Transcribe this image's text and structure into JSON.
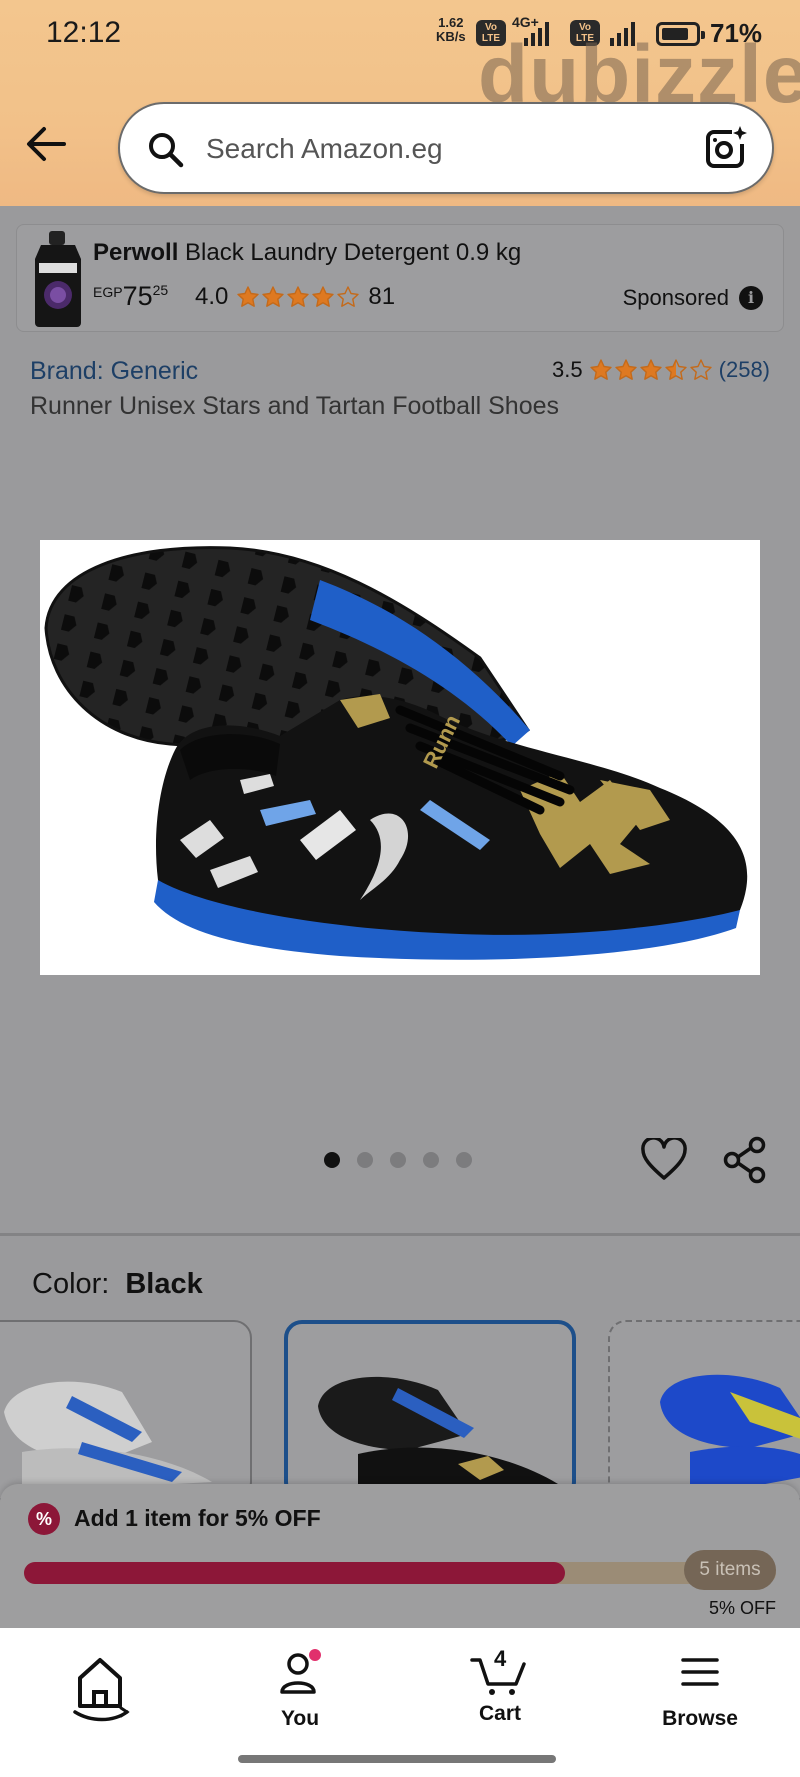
{
  "status_bar": {
    "time": "12:12",
    "net_speed": "1.62",
    "net_unit": "KB/s",
    "volte": "Vo LTE",
    "network": "4G+",
    "battery": "71%"
  },
  "watermark": "dubizzle",
  "search": {
    "placeholder": "Search Amazon.eg",
    "icons": [
      "back-arrow-icon",
      "search-icon",
      "camera-lens-icon"
    ]
  },
  "sponsored_ad": {
    "brand": "Perwoll",
    "title_rest": " Black Laundry Detergent 0.9 kg",
    "currency": "EGP",
    "price_whole": "75",
    "price_fraction": "25",
    "rating": "4.0",
    "stars": 4.0,
    "reviews": "81",
    "label": "Sponsored",
    "info_symbol": "i"
  },
  "product": {
    "brand_link": "Brand: Generic",
    "rating": "3.5",
    "stars": 3.5,
    "review_count": "(258)",
    "title": "Runner Unisex Stars and Tartan Football Shoes",
    "image_count": 5,
    "active_image": 0,
    "shoe_text": "Runn"
  },
  "color": {
    "label": "Color:",
    "value": "Black",
    "swatches": [
      {
        "name": "white-blue",
        "selected": false
      },
      {
        "name": "black-blue-gold",
        "selected": true
      },
      {
        "name": "blue-yellow",
        "selected": false
      }
    ]
  },
  "promo": {
    "badge": "%",
    "message": "Add 1 item for 5% OFF",
    "progress": 0.72,
    "pill": "5 items",
    "discount": "5% OFF",
    "accent": "#8c1738"
  },
  "nav": {
    "home": "",
    "you": "You",
    "cart": "Cart",
    "cart_count": "4",
    "browse": "Browse"
  }
}
